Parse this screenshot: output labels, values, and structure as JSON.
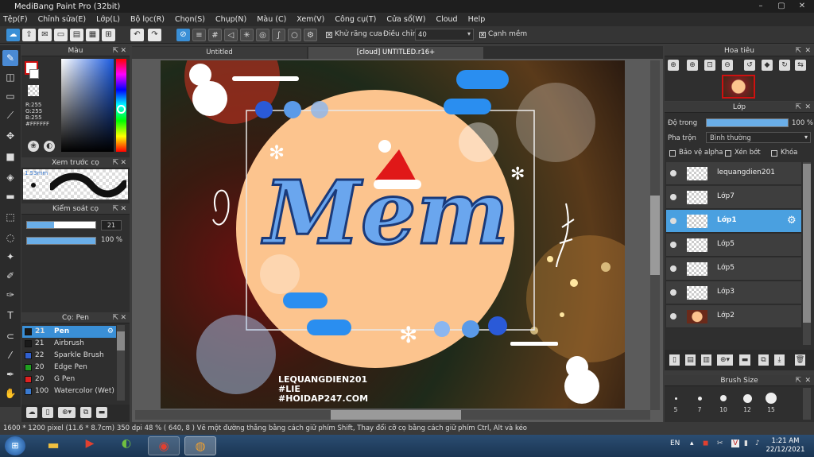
{
  "app": {
    "title": "MediBang Paint Pro (32bit)"
  },
  "menu": [
    "Tệp(F)",
    "Chỉnh sửa(E)",
    "Lớp(L)",
    "Bộ lọc(R)",
    "Chọn(S)",
    "Chụp(N)",
    "Màu (C)",
    "Xem(V)",
    "Công cụ(T)",
    "Cửa sổ(W)",
    "Cloud",
    "Help"
  ],
  "toolbar": {
    "antialias_label": "Khử răng cưa",
    "correction_label": "Điều chỉnh",
    "correction_value": "40",
    "sharp_label": "Cạnh mềm"
  },
  "color_panel": {
    "title": "Màu",
    "r": "R:255",
    "g": "G:255",
    "b": "B:255",
    "hex": "#FFFFFF"
  },
  "brush_preview": {
    "title": "Xem trước cọ",
    "size": "1.53mm"
  },
  "brush_control": {
    "title": "Kiểm soát cọ",
    "size_value": "21",
    "opacity_value": "100 %"
  },
  "brush_panel": {
    "title": "Cọ: Pen",
    "brushes": [
      {
        "size": "21",
        "name": "Pen",
        "color": "#1a1a1a"
      },
      {
        "size": "21",
        "name": "Airbrush",
        "color": "#1a1a1a"
      },
      {
        "size": "22",
        "name": "Sparkle Brush",
        "color": "#3060d0"
      },
      {
        "size": "20",
        "name": "Edge Pen",
        "color": "#20a020"
      },
      {
        "size": "20",
        "name": "G Pen",
        "color": "#e02020"
      },
      {
        "size": "100",
        "name": "Watercolor (Wet)",
        "color": "#3a7ad0"
      }
    ]
  },
  "tabs": {
    "tab1": "Untitled",
    "tab2": "[cloud] UNTITLED.r16+"
  },
  "artwork": {
    "text1": "LEQUANGDIEN201",
    "text2": "#LIE",
    "text3": "#HOIDAP247.COM"
  },
  "navigator": {
    "title": "Hoa tiêu"
  },
  "layer_panel": {
    "title": "Lớp",
    "opacity_label": "Độ trong",
    "opacity_value": "100 %",
    "blend_label": "Pha trộn",
    "blend_value": "Bình thường",
    "protect_alpha": "Bảo vệ alpha",
    "clip": "Xén bớt",
    "lock": "Khóa",
    "layers": [
      "lequangdien201",
      "Lớp7",
      "Lớp1",
      "Lớp5",
      "Lớp5",
      "Lớp3",
      "Lớp2"
    ]
  },
  "brush_size": {
    "title": "Brush Size",
    "sizes": [
      "5",
      "7",
      "10",
      "12",
      "15"
    ]
  },
  "status": {
    "text": "1600 * 1200 pixel  (11.6 * 8.7cm)  350 dpi  48 %  ( 640, 8 )  Vẽ một đường thẳng bằng cách giữ phím Shift, Thay đổi cỡ cọ bằng cách giữ phím Ctrl, Alt và kéo"
  },
  "taskbar": {
    "lang": "EN",
    "time": "1:21 AM",
    "date": "22/12/2021"
  }
}
